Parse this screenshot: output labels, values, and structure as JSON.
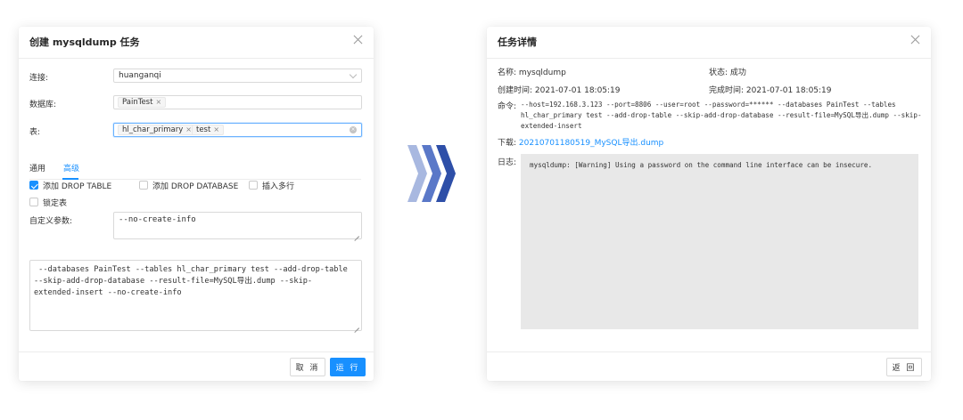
{
  "create_dialog": {
    "title": "创建 mysqldump 任务",
    "connection": {
      "label": "连接:",
      "value": "huanganqi"
    },
    "database": {
      "label": "数据库:",
      "tags": [
        "PainTest"
      ]
    },
    "table": {
      "label": "表:",
      "tags": [
        "hl_char_primary",
        "test"
      ]
    },
    "tabs": [
      {
        "label": "通用",
        "active": false
      },
      {
        "label": "高级",
        "active": true
      }
    ],
    "options": [
      {
        "label": "添加 DROP TABLE",
        "checked": true
      },
      {
        "label": "添加 DROP DATABASE",
        "checked": false
      },
      {
        "label": "插入多行",
        "checked": false
      },
      {
        "label": "锁定表",
        "checked": false
      }
    ],
    "custom_params": {
      "label": "自定义参数:",
      "value": "--no-create-info"
    },
    "command_preview": [
      " --databases PainTest --tables hl_char_primary test --add-drop-table",
      "--skip-add-drop-database --result-file=MySQL导出.dump --skip-",
      "extended-insert --no-create-info"
    ],
    "cancel_label": "取 消",
    "run_label": "运 行"
  },
  "detail_dialog": {
    "title": "任务详情",
    "name": {
      "label": "名称:",
      "value": "mysqldump"
    },
    "status": {
      "label": "状态:",
      "value": "成功"
    },
    "created": {
      "label": "创建时间:",
      "value": "2021-07-01 18:05:19"
    },
    "finished": {
      "label": "完成时间:",
      "value": "2021-07-01 18:05:19"
    },
    "command": {
      "label": "命令:",
      "lines": [
        "--host=192.168.3.123 --port=8806 --user=root --password=****** --databases PainTest --tables",
        "hl_char_primary test --add-drop-table --skip-add-drop-database --result-file=MySQL导出.dump --skip-",
        "extended-insert"
      ]
    },
    "download": {
      "label": "下载:",
      "link": "20210701180519_MySQL导出.dump"
    },
    "log": {
      "label": "日志:",
      "text": "mysqldump: [Warning] Using a password on the command line interface can be insecure."
    },
    "back_label": "返 回"
  },
  "colors": {
    "accent": "#1890ff",
    "arrow_light": "#a8b8e0",
    "arrow_mid": "#5a78c8",
    "arrow_dark": "#2e4fa8"
  },
  "icons": [
    "close-icon",
    "chevron-down-icon",
    "tag-remove-icon",
    "clear-icon",
    "checkbox-icon",
    "resize-handle-icon",
    "triple-chevron-right-icon"
  ]
}
